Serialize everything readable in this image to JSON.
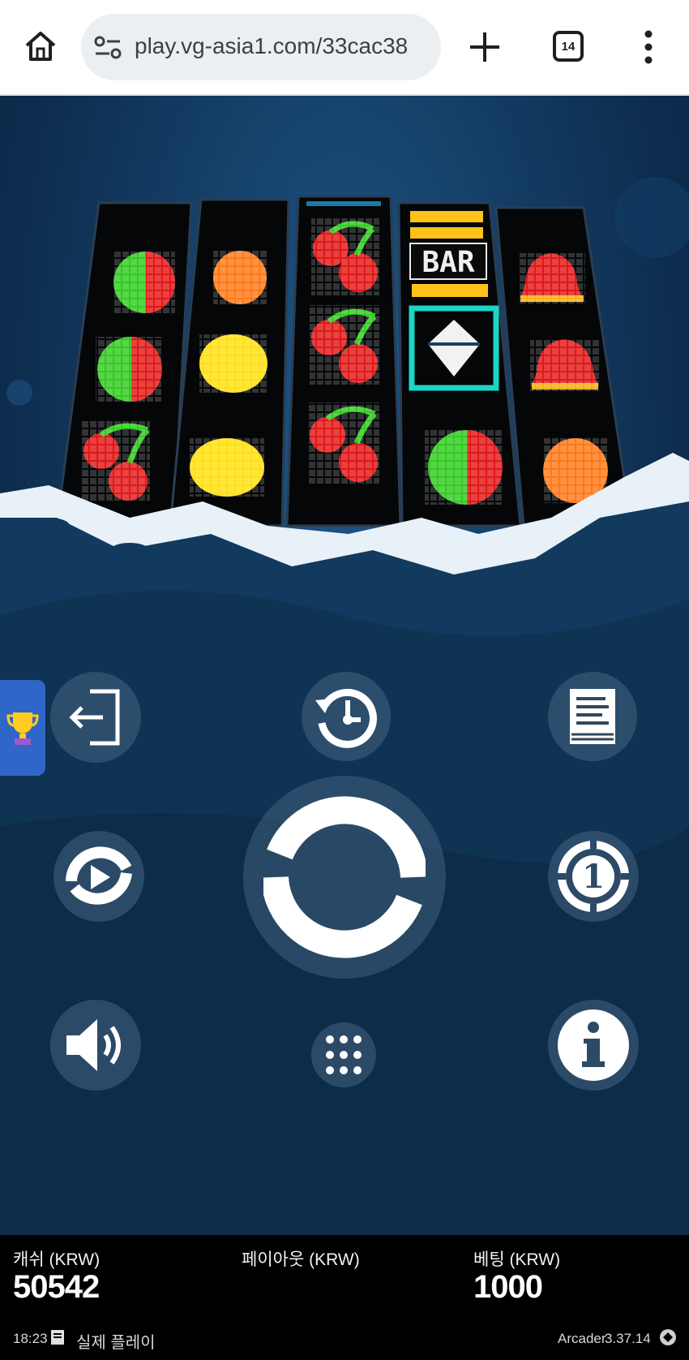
{
  "browser": {
    "url": "play.vg-asia1.com/33cac38",
    "tab_count": "14"
  },
  "game": {
    "reels": [
      [
        "apple",
        "apple",
        "cherry"
      ],
      [
        "orange",
        "lemon",
        "lemon"
      ],
      [
        "cherry",
        "cherry",
        "cherry"
      ],
      [
        "bar",
        "diamond",
        "apple"
      ],
      [
        "bell",
        "bell",
        "orange"
      ]
    ],
    "colors": {
      "accent": "#2f66c7",
      "background": "#0f2a44"
    }
  },
  "controls": {
    "exit": "exit-icon",
    "history": "history-icon",
    "paytable": "document-icon",
    "autoplay": "autoplay-icon",
    "spin": "spin-icon",
    "bet": "chip-icon",
    "sound": "speaker-icon",
    "menu": "grid-icon",
    "info": "info-icon"
  },
  "status": {
    "cash_label": "캐쉬 (KRW)",
    "cash_value": "50542",
    "payout_label": "페이아웃 (KRW)",
    "payout_value": "",
    "bet_label": "베팅 (KRW)",
    "bet_value": "1000",
    "time": "18:23",
    "mode": "실제 플레이",
    "brand": "Arcader",
    "version": "3.37.14"
  }
}
